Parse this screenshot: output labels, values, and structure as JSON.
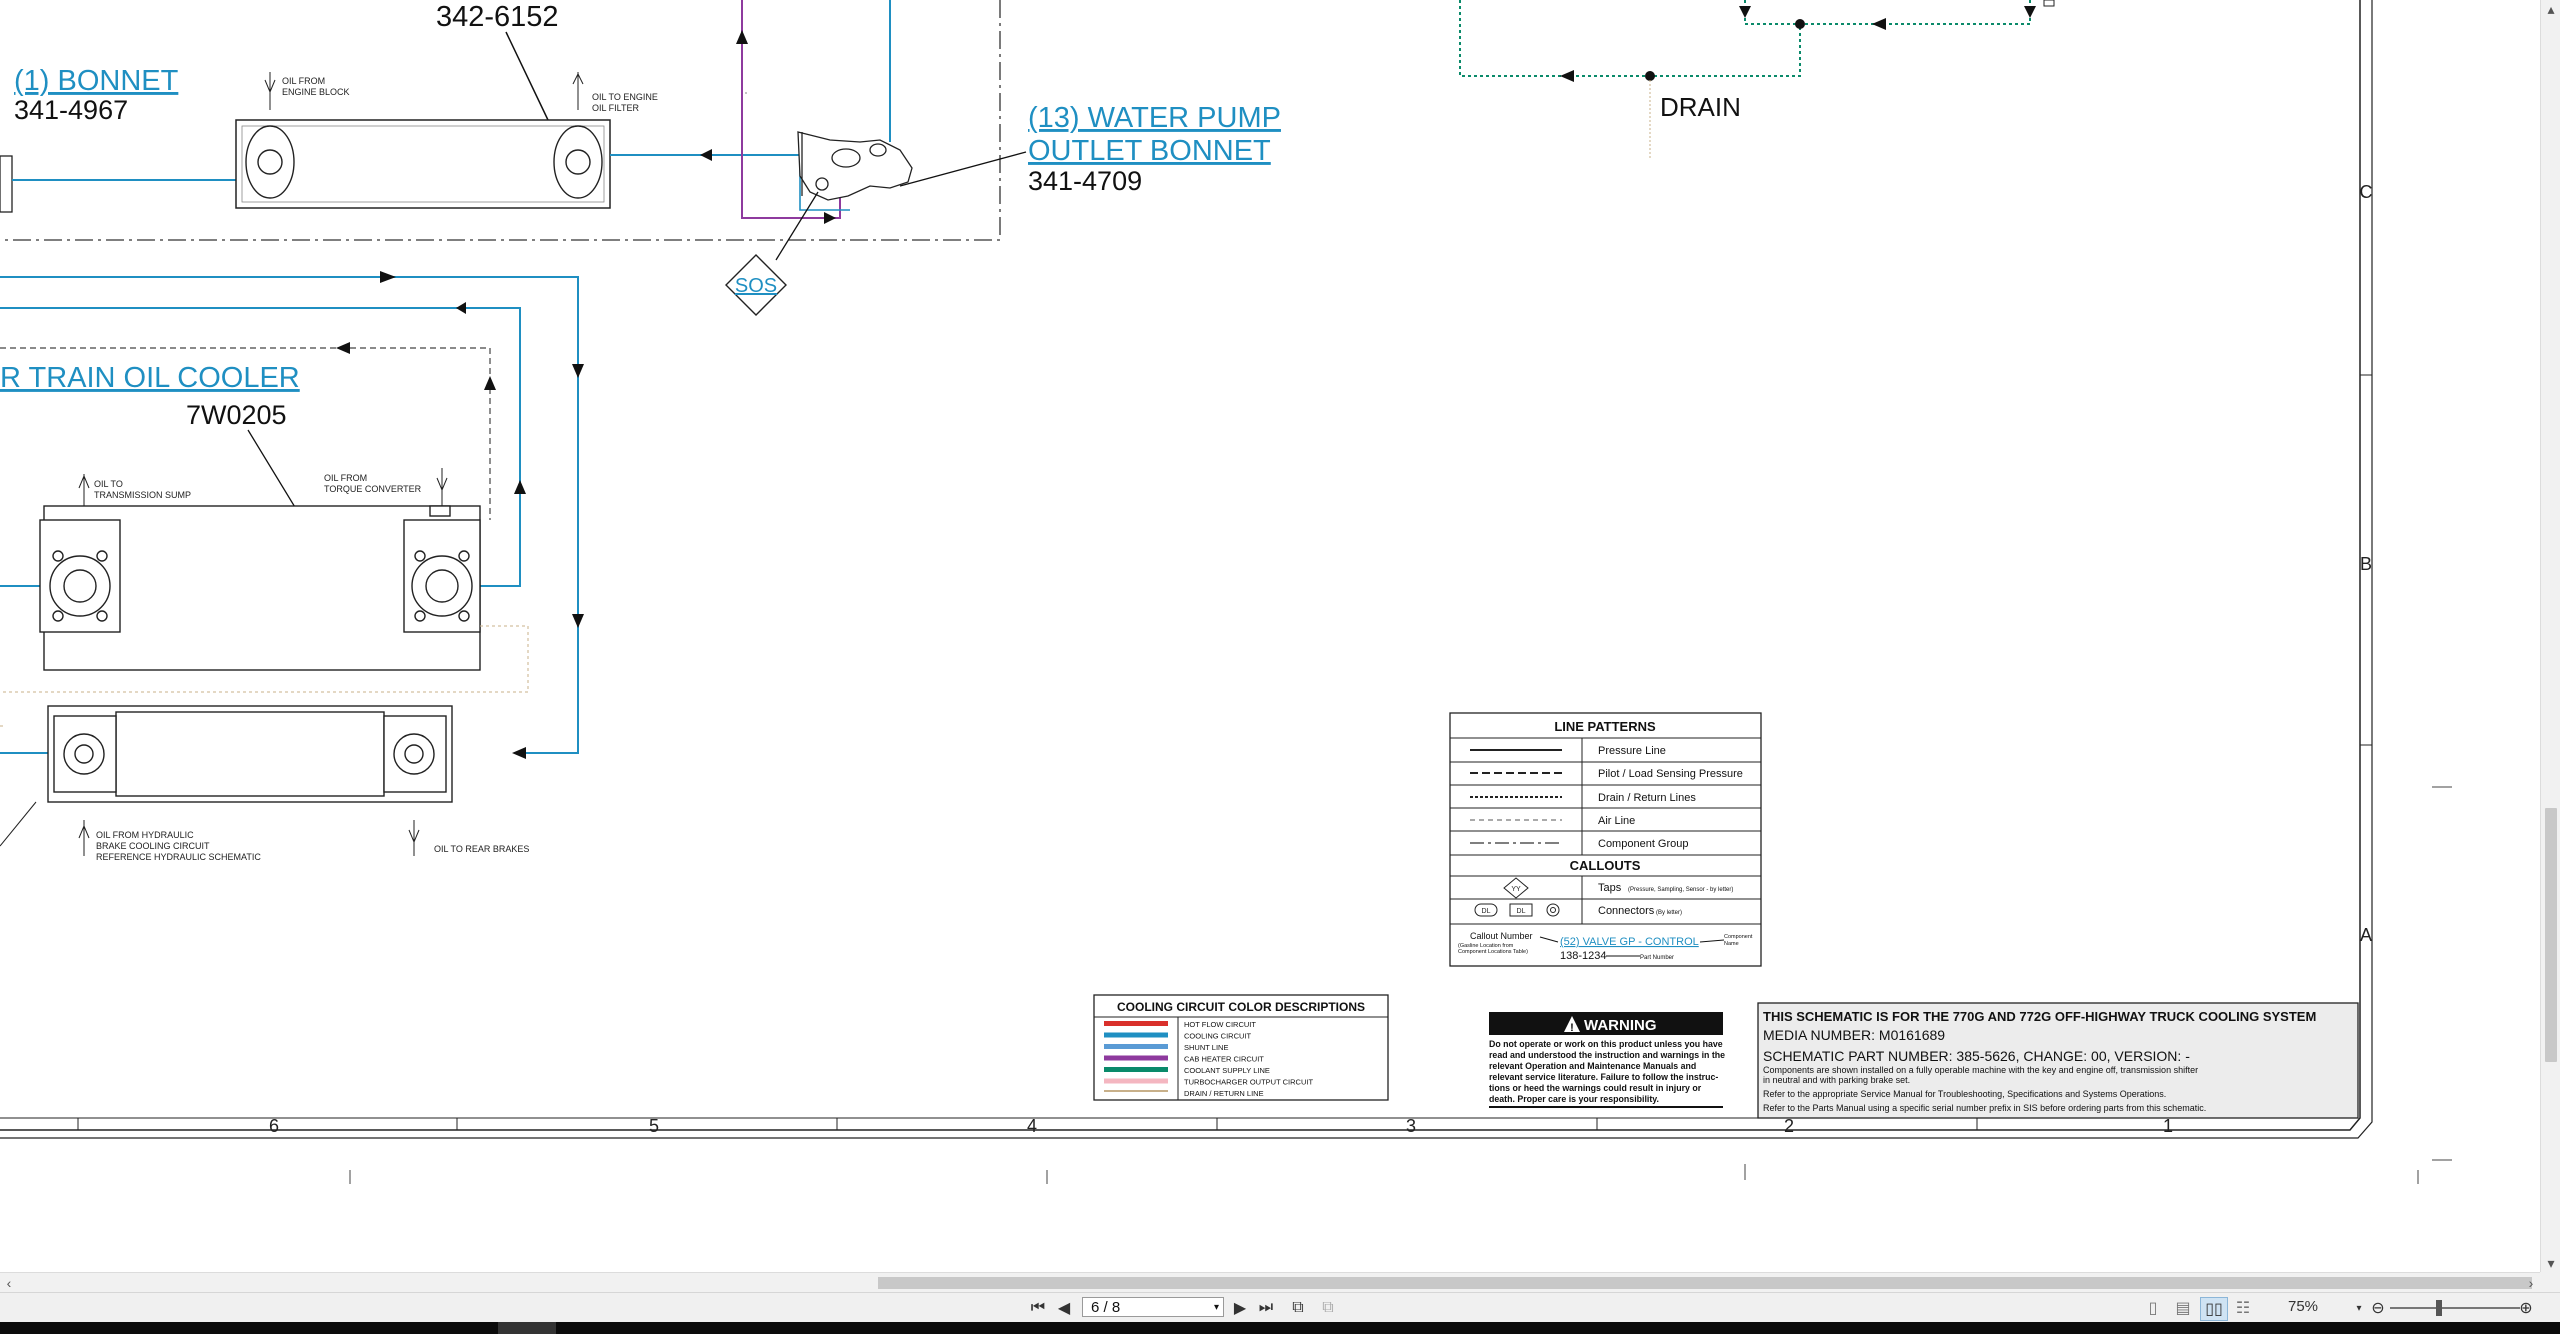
{
  "diagram": {
    "top_part_number": "342-6152",
    "bonnet_label": "(1) BONNET",
    "bonnet_part": "341-4967",
    "oil_from_engine_block": [
      "OIL FROM",
      "ENGINE BLOCK"
    ],
    "oil_to_engine_oil_filter": [
      "OIL TO ENGINE",
      "OIL FILTER"
    ],
    "water_pump_label_1": "(13) WATER PUMP",
    "water_pump_label_2": "OUTLET BONNET",
    "water_pump_part": "341-4709",
    "sos_label": "SOS",
    "drain_label": "DRAIN",
    "powertrain_cooler_label": "R TRAIN OIL COOLER",
    "powertrain_cooler_part": "7W0205",
    "oil_to_transmission_sump": [
      "OIL TO",
      "TRANSMISSION SUMP"
    ],
    "oil_from_torque_converter": [
      "OIL FROM",
      "TORQUE CONVERTER"
    ],
    "oil_from_hydraulic": [
      "OIL FROM HYDRAULIC",
      "BRAKE COOLING CIRCUIT",
      "REFERENCE HYDRAULIC SCHEMATIC"
    ],
    "oil_to_rear_brakes": "OIL TO REAR BRAKES"
  },
  "line_patterns": {
    "title": "LINE PATTERNS",
    "rows": [
      "Pressure Line",
      "Pilot / Load Sensing Pressure",
      "Drain / Return Lines",
      "Air Line",
      "Component Group"
    ],
    "callouts_title": "CALLOUTS",
    "taps_label": "Taps",
    "taps_note": "(Pressure, Sampling, Sensor - by letter)",
    "tap_symbol": "YY",
    "connectors_label": "Connectors",
    "connectors_note": "(By letter)",
    "connector_symbols": [
      "DL",
      "DL"
    ],
    "callout_number_label": "Callout Number",
    "callout_number_note": [
      "(Gasline Location from",
      "Component Locations Table)"
    ],
    "callout_example": "(52) VALVE GP - CONTROL",
    "callout_part": "138-1234",
    "component_name_label": [
      "Component",
      "Name"
    ],
    "part_number_label": "Part Number"
  },
  "color_descriptions": {
    "title": "COOLING CIRCUIT COLOR DESCRIPTIONS",
    "items": [
      {
        "label": "HOT FLOW CIRCUIT",
        "color": "#d9302b"
      },
      {
        "label": "COOLING CIRCUIT",
        "color": "#1f8fc2"
      },
      {
        "label": "SHUNT LINE",
        "color": "#5a9bd5"
      },
      {
        "label": "CAB HEATER CIRCUIT",
        "color": "#8e3a9e"
      },
      {
        "label": "COOLANT SUPPLY LINE",
        "color": "#0a8a6a"
      },
      {
        "label": "TURBOCHARGER OUTPUT CIRCUIT",
        "color": "#f4b6c0"
      },
      {
        "label": "DRAIN / RETURN LINE",
        "color": "#c8b08a"
      }
    ]
  },
  "warning": {
    "title": "WARNING",
    "lines": [
      "Do not operate or work on this product unless you have",
      "read and understood the instruction and warnings in the",
      "relevant Operation and Maintenance Manuals and",
      "relevant service literature. Failure to follow the instruc-",
      "tions or heed the warnings could result in injury or",
      "death. Proper care is your responsibility."
    ]
  },
  "title_block": {
    "title": "THIS SCHEMATIC IS FOR THE 770G AND 772G OFF-HIGHWAY TRUCK COOLING SYSTEM",
    "media_number": "MEDIA NUMBER: M0161689",
    "part_number": "SCHEMATIC PART NUMBER: 385-5626, CHANGE: 00, VERSION: -",
    "notes": [
      "Components are shown installed on a fully operable machine with the key and engine off, transmission shifter",
      "in neutral and with parking brake set.",
      "Refer to the appropriate Service Manual for Troubleshooting, Specifications and Systems Operations.",
      "Refer to the Parts Manual using a specific serial number prefix in SIS before ordering parts from this schematic."
    ]
  },
  "border": {
    "column_numbers": [
      "6",
      "5",
      "4",
      "3",
      "2",
      "1"
    ],
    "row_letters": [
      "C",
      "B",
      "A"
    ]
  },
  "toolbar": {
    "page_value": "6 / 8",
    "zoom": "75%"
  }
}
